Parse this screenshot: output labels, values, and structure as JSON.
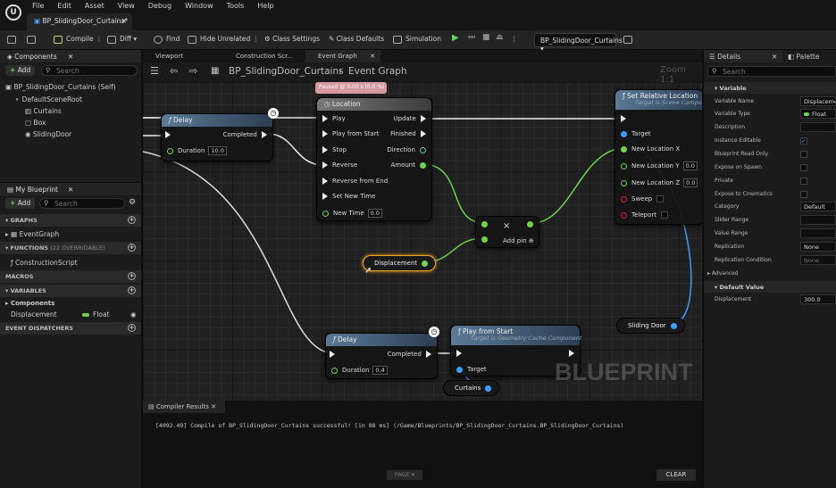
{
  "menu": [
    "File",
    "Edit",
    "Asset",
    "View",
    "Debug",
    "Window",
    "Tools",
    "Help"
  ],
  "document_tab": "BP_SlidingDoor_Curtains*",
  "toolbar": {
    "compile": "Compile",
    "diff": "Diff",
    "find": "Find",
    "hide_unrelated": "Hide Unrelated",
    "class_settings": "Class Settings",
    "class_defaults": "Class Defaults",
    "simulation": "Simulation",
    "debug_object": "BP_SlidingDoor_Curtains"
  },
  "components": {
    "title": "Components",
    "add": "Add",
    "search_placeholder": "Search",
    "items": [
      "BP_SlidingDoor_Curtains (Self)",
      "DefaultSceneRoot",
      "Curtains",
      "Box",
      "SlidingDoor"
    ]
  },
  "my_blueprint": {
    "title": "My Blueprint",
    "add": "Add",
    "search_placeholder": "Search",
    "graphs_label": "GRAPHS",
    "event_graph": "EventGraph",
    "functions_label": "FUNCTIONS",
    "functions_count": "(22 OVERRIDABLE)",
    "construction_script": "ConstructionScript",
    "macros_label": "MACROS",
    "variables_label": "VARIABLES",
    "components_label": "Components",
    "var_name": "Displacement",
    "var_type": "Float",
    "dispatchers_label": "EVENT DISPATCHERS"
  },
  "graph_tabs": [
    "Viewport",
    "Construction Scr...",
    "Event Graph"
  ],
  "breadcrumb": {
    "blueprint": "BP_SlidingDoor_Curtains",
    "graph": "Event Graph",
    "zoom": "Zoom 1:1"
  },
  "nodes": {
    "delay1": {
      "title": "Delay",
      "completed": "Completed",
      "duration_label": "Duration",
      "duration": "10.0"
    },
    "timeline": {
      "title": "Location",
      "paused": "Paused @ 0.00 s (0.0 %)",
      "inputs": [
        "Play",
        "Play from Start",
        "Stop",
        "Reverse",
        "Reverse from End",
        "Set New Time",
        "New Time"
      ],
      "new_time": "0.0",
      "outputs": [
        "Update",
        "Finished",
        "Direction",
        "Amount"
      ]
    },
    "multiply": {
      "symbol": "×",
      "add_pin": "Add pin"
    },
    "displacement": "Displacement",
    "set_location": {
      "title": "Set Relative Location",
      "subtitle": "Target is Scene Component",
      "target": "Target",
      "x": "New Location X",
      "y": "New Location Y",
      "y_val": "0.0",
      "z": "New Location Z",
      "z_val": "0.0",
      "sweep": "Sweep",
      "teleport": "Teleport"
    },
    "sliding_door": "Sliding Door",
    "delay2": {
      "title": "Delay",
      "completed": "Completed",
      "duration_label": "Duration",
      "duration": "0.4"
    },
    "play_from_start": {
      "title": "Play from Start",
      "subtitle": "Target is Geometry Cache Component",
      "target": "Target"
    },
    "curtains": "Curtains"
  },
  "watermark": "BLUEPRINT",
  "compiler": {
    "tab": "Compiler Results",
    "message": "[4092.49] Compile of BP_SlidingDoor_Curtains successful! [in 88 ms] (/Game/Blueprints/BP_SlidingDoor_Curtains.BP_SlidingDoor_Curtains)",
    "page": "PAGE",
    "clear": "CLEAR"
  },
  "details": {
    "tab": "Details",
    "palette": "Palette",
    "search_placeholder": "Search",
    "variable_section": "Variable",
    "rows": [
      {
        "label": "Variable Name",
        "value": "Displacement"
      },
      {
        "label": "Variable Type",
        "value": "Float"
      },
      {
        "label": "Description",
        "value": ""
      },
      {
        "label": "Instance Editable",
        "value": "checked"
      },
      {
        "label": "Blueprint Read Only",
        "value": ""
      },
      {
        "label": "Expose on Spawn",
        "value": ""
      },
      {
        "label": "Private",
        "value": ""
      },
      {
        "label": "Expose to Cinematics",
        "value": ""
      },
      {
        "label": "Category",
        "value": "Default"
      },
      {
        "label": "Slider Range",
        "value": ""
      },
      {
        "label": "Value Range",
        "value": ""
      },
      {
        "label": "Replication",
        "value": "None"
      },
      {
        "label": "Replication Condition",
        "value": "None"
      }
    ],
    "advanced": "Advanced",
    "default_value_section": "Default Value",
    "default_label": "Displacement",
    "default_value": "300.0"
  },
  "colors": {
    "exec": "#eeeeee",
    "float": "#6fd34f",
    "object": "#3aa0ff",
    "bool": "#dd2222",
    "selection": "#f0a020"
  }
}
